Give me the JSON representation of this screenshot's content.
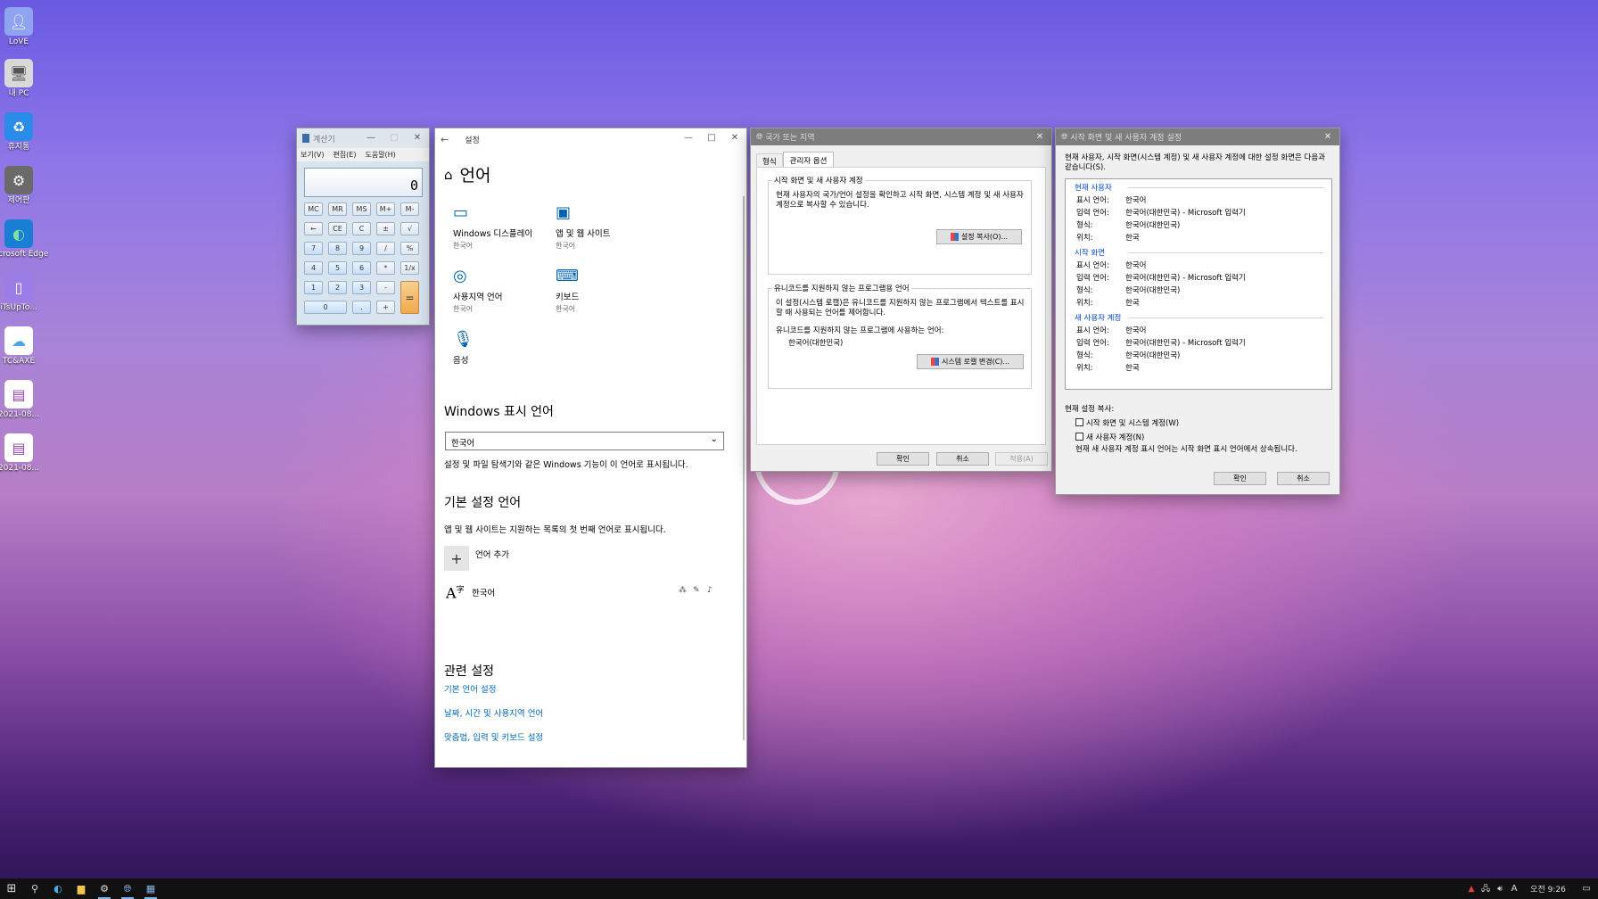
{
  "desktop_icons": [
    {
      "label": "LoVE",
      "icon": "user-folder-icon"
    },
    {
      "label": "내 PC",
      "icon": "computer-icon"
    },
    {
      "label": "휴지통",
      "icon": "recycle-bin-icon"
    },
    {
      "label": "제어판",
      "icon": "control-panel-icon"
    },
    {
      "label": "Microsoft Edge",
      "icon": "edge-icon"
    },
    {
      "label": "iTsUpTo...",
      "icon": "file-icon"
    },
    {
      "label": "TC&AXE",
      "icon": "cloud-icon"
    },
    {
      "label": "2021-08...",
      "icon": "screenshot-icon"
    },
    {
      "label": "2021-08...",
      "icon": "screenshot-icon"
    }
  ],
  "calculator": {
    "title": "계산기",
    "menu": [
      "보기(V)",
      "편집(E)",
      "도움말(H)"
    ],
    "display": "0",
    "buttons": [
      "MC",
      "MR",
      "MS",
      "M+",
      "M-",
      "←",
      "CE",
      "C",
      "±",
      "√",
      "7",
      "8",
      "9",
      "/",
      "%",
      "4",
      "5",
      "6",
      "*",
      "1/x",
      "1",
      "2",
      "3",
      "-",
      "=",
      "0",
      ".",
      "+"
    ]
  },
  "settings": {
    "title": "설정",
    "page_title": "언어",
    "tiles": [
      {
        "name": "Windows 디스플레이",
        "sub": "한국어",
        "icon": "display-icon"
      },
      {
        "name": "앱 및 웹 사이트",
        "sub": "한국어",
        "icon": "app-window-icon"
      },
      {
        "name": "사용지역 언어",
        "sub": "한국어",
        "icon": "region-globe-icon"
      },
      {
        "name": "키보드",
        "sub": "한국어",
        "icon": "keyboard-icon"
      },
      {
        "name": "음성",
        "sub": "",
        "icon": "microphone-icon"
      }
    ],
    "display_language_heading": "Windows 표시 언어",
    "display_language_value": "한국어",
    "display_language_desc": "설정 및 파일 탐색기와 같은 Windows 기능이 이 언어로 표시됩니다.",
    "preferred_heading": "기본 설정 언어",
    "preferred_desc": "앱 및 웹 사이트는 지원하는 목록의 첫 번째 언어로 표시됩니다.",
    "add_language": "언어 추가",
    "language_item": "한국어",
    "related_heading": "관련 설정",
    "links": [
      "기본 언어 설정",
      "날짜, 시간 및 사용지역 언어",
      "맞춤법, 입력 및 키보드 설정"
    ]
  },
  "region_dialog": {
    "title": "국가 또는 지역",
    "tabs": [
      "형식",
      "관리자 옵션"
    ],
    "group1_title": "시작 화면 및 새 사용자 계정",
    "group1_text": "현재 사용자의 국가/언어 설정을 확인하고 시작 화면, 시스템 계정 및 새 사용자 계정으로 복사할 수 있습니다.",
    "copy_settings_button": "설정 복사(O)...",
    "group2_title": "유니코드를 지원하지 않는 프로그램용 언어",
    "group2_text": "이 설정(시스템 로캘)은 유니코드를 지원하지 않는 프로그램에서 텍스트를 표시할 때 사용되는 언어를 제어합니다.",
    "group2_label": "유니코드를 지원하지 않는 프로그램에 사용하는 언어:",
    "group2_value": "한국어(대한민국)",
    "change_locale_button": "시스템 로캘 변경(C)...",
    "ok": "확인",
    "cancel": "취소",
    "apply": "적용(A)"
  },
  "welcome_dialog": {
    "title": "시작 화면 및 새 사용자 계정 설정",
    "intro": "현재 사용자, 시작 화면(시스템 계정) 및 새 사용자 계정에 대한 설정 화면은 다음과 같습니다(S).",
    "labels": {
      "display": "표시 언어:",
      "input": "입력 언어:",
      "format": "형식:",
      "location": "위치:"
    },
    "sections": [
      {
        "title": "현재 사용자",
        "display": "한국어",
        "input": "한국어(대한민국) - Microsoft 입력기",
        "format": "한국어(대한민국)",
        "location": "한국"
      },
      {
        "title": "시작 화면",
        "display": "한국어",
        "input": "한국어(대한민국) - Microsoft 입력기",
        "format": "한국어(대한민국)",
        "location": "한국"
      },
      {
        "title": "새 사용자 계정",
        "display": "한국어",
        "input": "한국어(대한민국) - Microsoft 입력기",
        "format": "한국어(대한민국)",
        "location": "한국"
      }
    ],
    "copy_heading": "현재 설정 복사:",
    "check1": "시작 화면 및 시스템 계정(W)",
    "check2": "새 사용자 계정(N)",
    "note": "현재 새 사용자 계정 표시 언어는 시작 화면 표시 언어에서 상속됩니다.",
    "ok": "확인",
    "cancel": "취소"
  },
  "taskbar": {
    "tray_ime": "A",
    "clock": "오전 9:26"
  }
}
